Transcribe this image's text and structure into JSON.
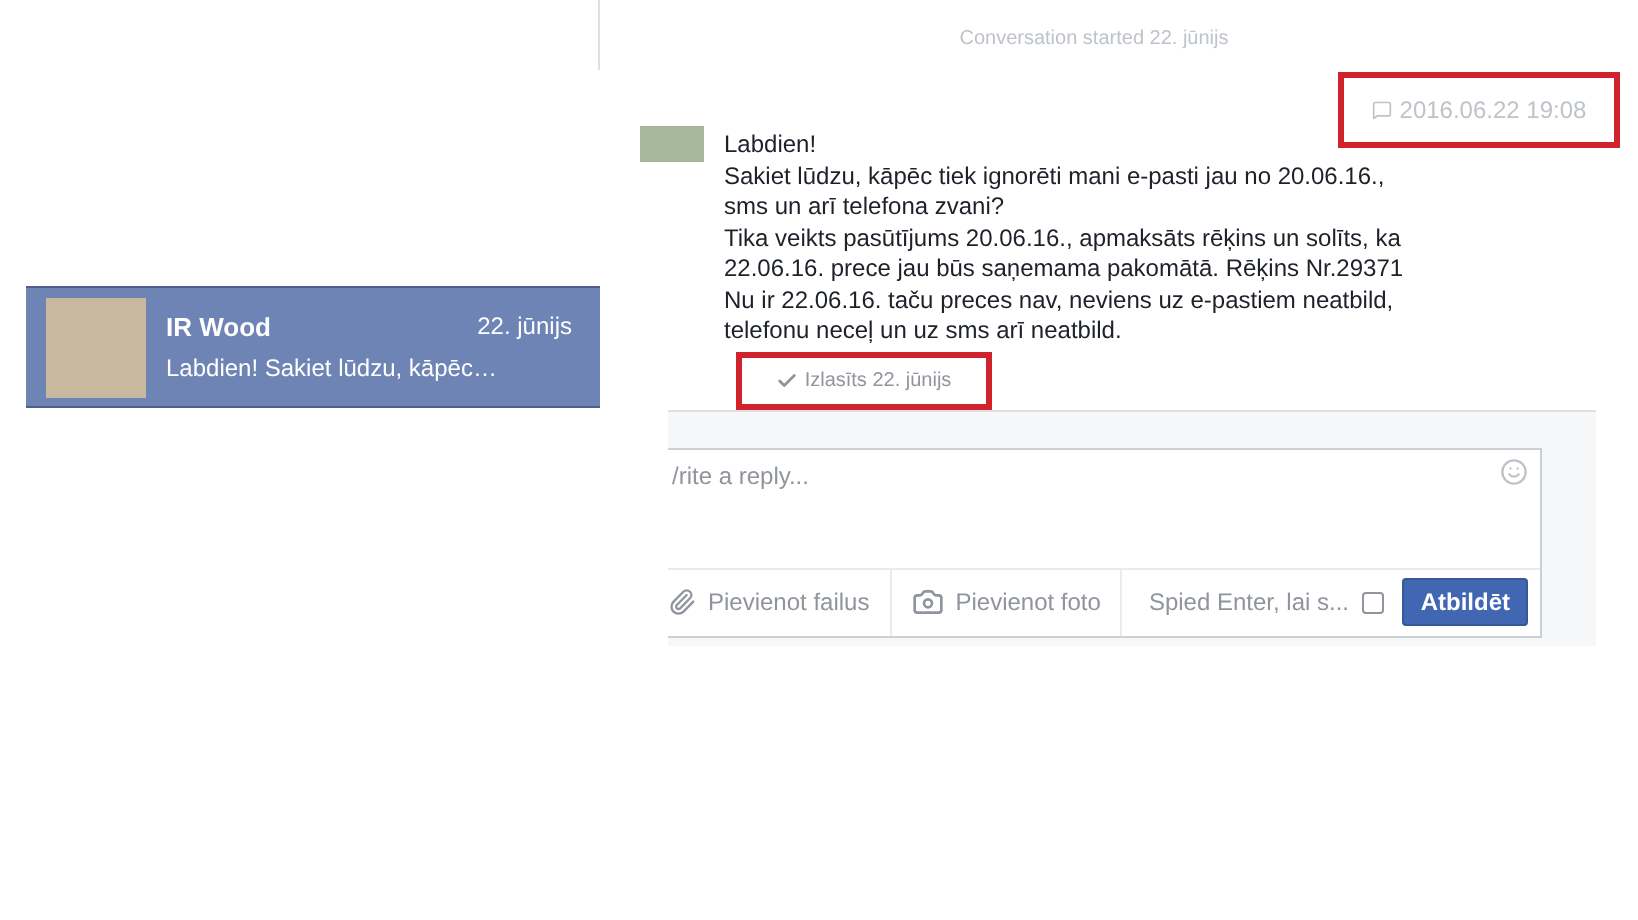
{
  "sidebar": {
    "items": [
      {
        "name": "IR Wood",
        "date": "22. jūnijs",
        "preview": "Labdien! Sakiet lūdzu, kāpēc…",
        "selected": true
      }
    ]
  },
  "conversation": {
    "started": "Conversation started 22. jūnijs",
    "timestamp": "2016.06.22 19:08",
    "message": [
      "Labdien!",
      "Sakiet lūdzu, kāpēc tiek ignorēti mani e-pasti jau no 20.06.16.,",
      "sms un arī telefona zvani?",
      "Tika veikts pasūtījums 20.06.16., apmaksāts rēķins un solīts, ka",
      "22.06.16. prece jau būs saņemama pakomātā. Rēķins Nr.29371",
      "Nu ir 22.06.16. taču preces nav, neviens uz e-pastiem neatbild,",
      "telefonu neceļ un uz sms arī neatbild."
    ],
    "read_receipt": "Izlasīts 22. jūnijs"
  },
  "reply": {
    "placeholder": "/rite a reply...",
    "attach_files": "Pievienot failus",
    "attach_photo": "Pievienot foto",
    "enter_to_send": {
      "label": "Spied Enter, lai s...",
      "checked": false
    },
    "send": "Atbildēt"
  }
}
